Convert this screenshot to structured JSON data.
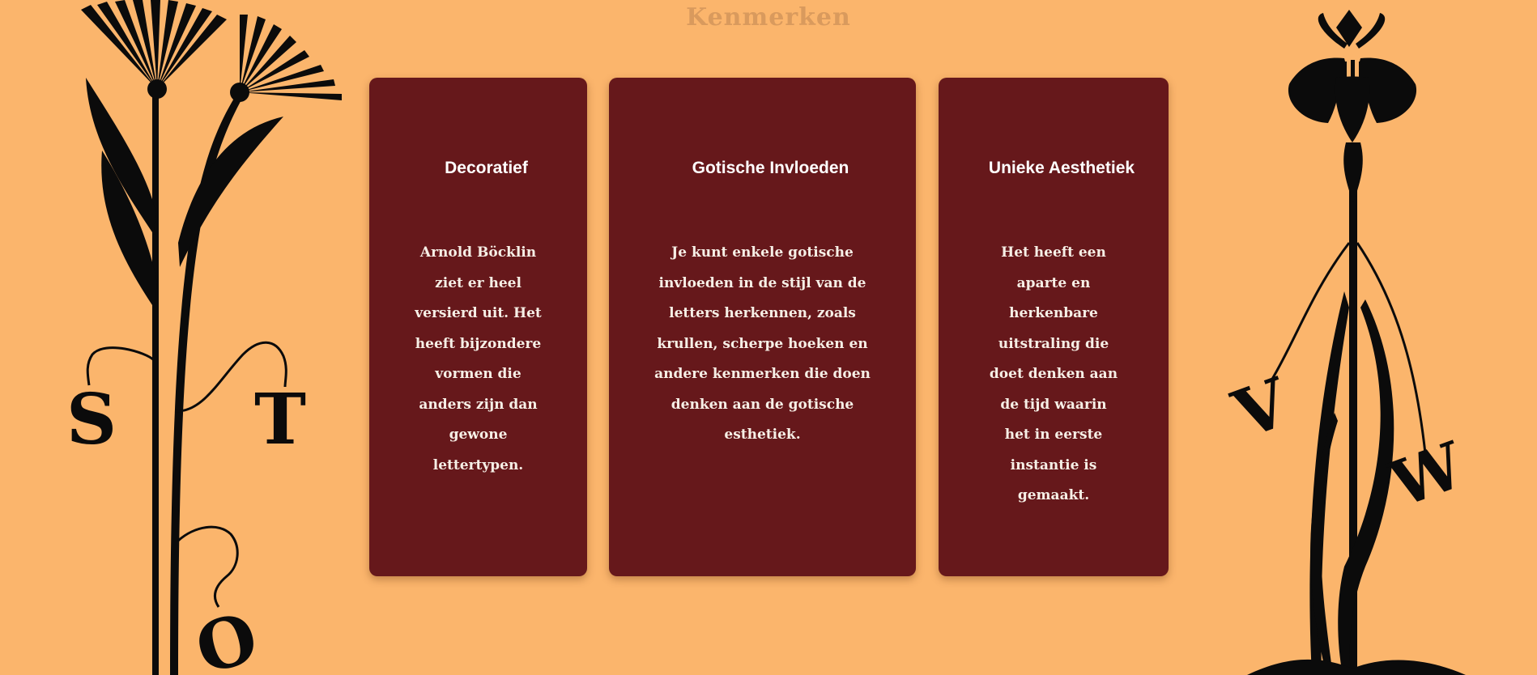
{
  "page": {
    "title": "Kenmerken"
  },
  "cards": [
    {
      "title": "Decoratief",
      "text": "Arnold Böcklin ziet er heel versierd uit. Het heeft bijzondere vormen die anders zijn dan gewone lettertypen."
    },
    {
      "title": "Gotische Invloeden",
      "text": "Je kunt enkele gotische invloeden in de stijl van de letters herkennen, zoals krullen, scherpe hoeken en andere kenmerken die doen denken aan de gotische esthetiek."
    },
    {
      "title": "Unieke Aesthetiek",
      "text": "Het heeft een aparte en herkenbare uitstraling die doet denken aan de tijd waarin het in eerste instantie is gemaakt."
    }
  ],
  "decorations": {
    "left_letters": [
      "S",
      "T",
      "O"
    ],
    "right_letters": [
      "V",
      "W"
    ],
    "left_icon": "flower-stems-illustration",
    "right_icon": "iris-flower-illustration"
  },
  "colors": {
    "background": "#fbb56c",
    "card": "#66181b",
    "title": "#d99a5d",
    "ornament": "#0b0b0b"
  }
}
